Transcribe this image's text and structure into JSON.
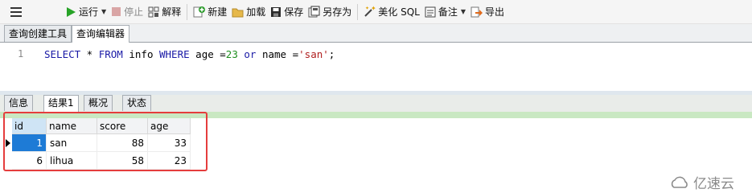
{
  "toolbar": {
    "run_label": "运行",
    "stop_label": "停止",
    "explain_label": "解释",
    "new_label": "新建",
    "load_label": "加载",
    "save_label": "保存",
    "save_as_label": "另存为",
    "beautify_label": "美化 SQL",
    "notes_label": "备注",
    "export_label": "导出"
  },
  "editor_tabs": [
    "查询创建工具",
    "查询编辑器"
  ],
  "code": {
    "line_number": "1",
    "t1": "SELECT",
    "t2": " * ",
    "t3": "FROM",
    "t4": " info ",
    "t5": "WHERE",
    "t6": " age =",
    "t7": "23",
    "t8": " ",
    "t9": "or",
    "t10": " name =",
    "t11": "'san'",
    "t12": ";"
  },
  "result_tabs": [
    "信息",
    "结果1",
    "概况",
    "状态"
  ],
  "grid": {
    "columns": [
      "id",
      "name",
      "score",
      "age"
    ],
    "rows": [
      [
        "1",
        "san",
        "88",
        "33"
      ],
      [
        "6",
        "lihua",
        "58",
        "23"
      ]
    ]
  },
  "watermark": "亿速云",
  "colors": {
    "keyword": "#1a1aa6",
    "number": "#1f8f1f",
    "string": "#b01f1f",
    "highlight_box": "#e53d3d",
    "selected_cell": "#1e7bd6"
  }
}
